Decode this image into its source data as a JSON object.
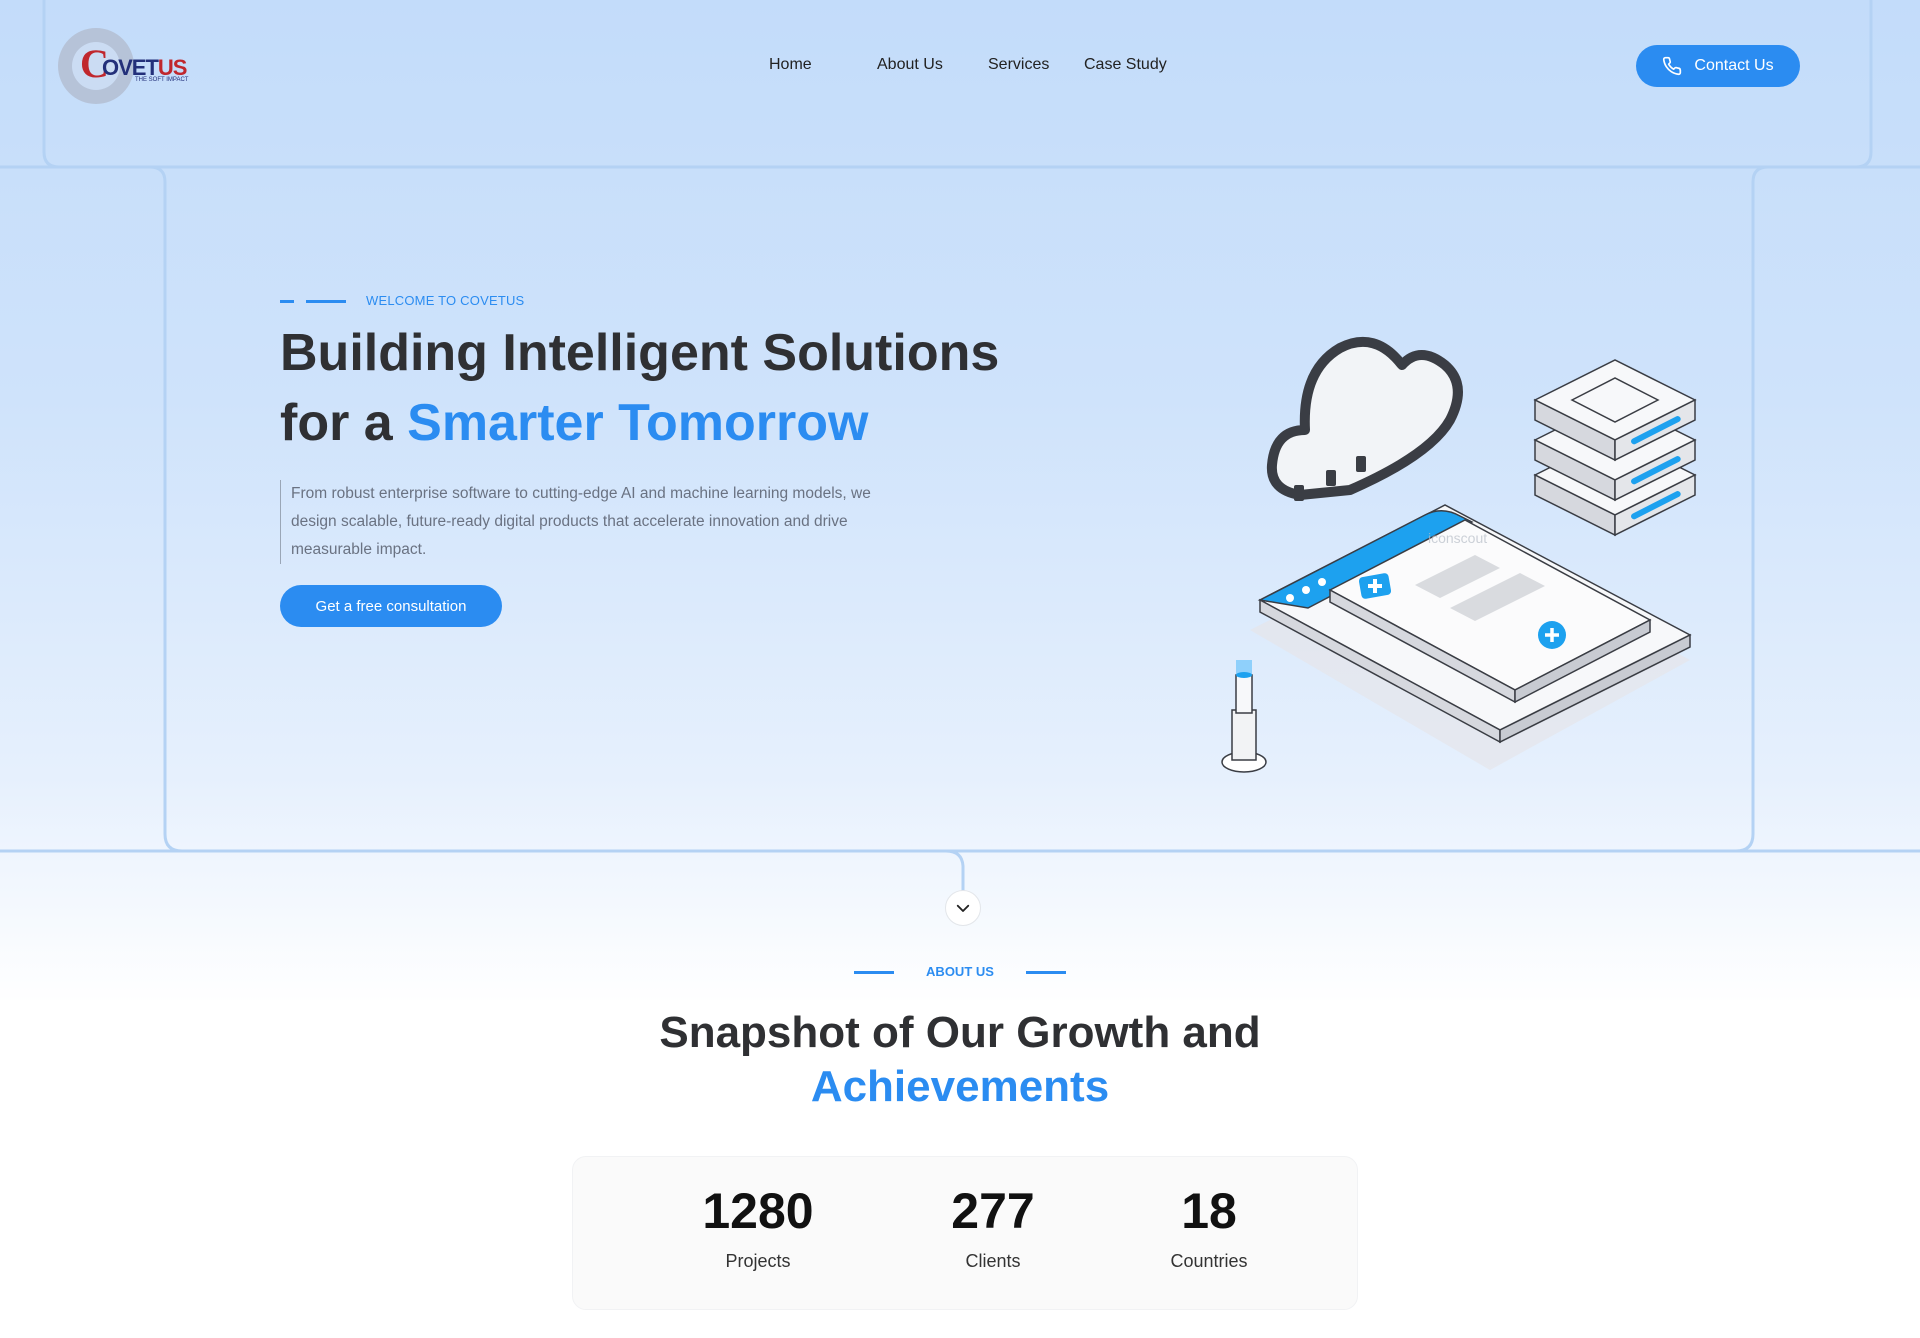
{
  "brand": {
    "logo_letter": "C",
    "logo_word": "OVET",
    "logo_word_suffix": "US",
    "tagline": "THE SOFT IMPACT",
    "colors": {
      "primary": "#2b8cf1",
      "navy": "#23307a",
      "red": "#c0272d"
    }
  },
  "nav": {
    "items": [
      {
        "label": "Home"
      },
      {
        "label": "About Us"
      },
      {
        "label": "Services"
      },
      {
        "label": "Case Study"
      }
    ],
    "contact_label": "Contact Us",
    "contact_icon": "phone-icon"
  },
  "hero": {
    "eyebrow": "WELCOME TO COVETUS",
    "title_line1": "Building Intelligent Solutions",
    "title_line2_prefix": "for a ",
    "title_line2_accent": "Smarter Tomorrow",
    "description": "From robust enterprise software to cutting-edge AI and machine learning models, we design scalable, future-ready digital products that accelerate innovation and drive measurable impact.",
    "cta_label": "Get a free consultation",
    "illustration": "isometric-cloud-server-illustration",
    "watermark": "iconscout",
    "scroll_icon": "chevron-down-icon"
  },
  "about": {
    "eyebrow": "ABOUT US",
    "title_line1": "Snapshot of Our Growth and",
    "title_line2": "Achievements",
    "stats": [
      {
        "value": "1280",
        "label": "Projects"
      },
      {
        "value": "277",
        "label": "Clients"
      },
      {
        "value": "18",
        "label": "Countries"
      }
    ]
  }
}
